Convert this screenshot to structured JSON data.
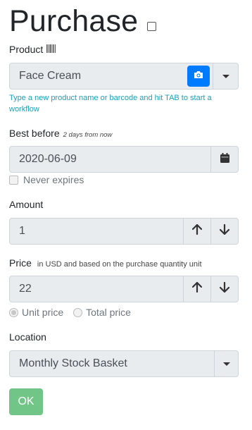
{
  "page": {
    "title": "Purchase"
  },
  "product": {
    "label": "Product",
    "icon": "barcode-icon",
    "value": "Face Cream",
    "help": "Type a new product name or barcode and hit TAB to start a workflow"
  },
  "best_before": {
    "label": "Best before",
    "hint": "2 days from now",
    "value": "2020-06-09",
    "never_expires_label": "Never expires"
  },
  "amount": {
    "label": "Amount",
    "value": "1"
  },
  "price": {
    "label": "Price",
    "hint": "in USD and based on the purchase quantity unit",
    "value": "22",
    "unit_price_label": "Unit price",
    "total_price_label": "Total price",
    "selected": "unit"
  },
  "location": {
    "label": "Location",
    "value": "Monthly Stock Basket"
  },
  "actions": {
    "ok_label": "OK"
  },
  "colors": {
    "primary": "#007bff",
    "help_text": "#17a2b8",
    "ok_button": "#71c587"
  }
}
